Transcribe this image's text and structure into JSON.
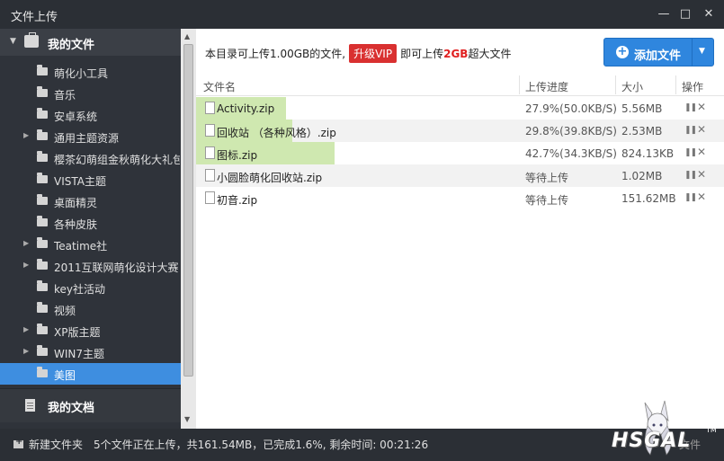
{
  "window": {
    "title": "文件上传",
    "minimize_icon": "—",
    "maximize_icon": "□",
    "close_icon": "✕"
  },
  "sidebar": {
    "header_label": "我的文件",
    "items": [
      {
        "label": "萌化小工具",
        "expandable": false
      },
      {
        "label": "音乐",
        "expandable": false
      },
      {
        "label": "安卓系统",
        "expandable": false
      },
      {
        "label": "通用主题资源",
        "expandable": true
      },
      {
        "label": "樱茶幻萌组金秋萌化大礼包",
        "expandable": false
      },
      {
        "label": "VISTA主题",
        "expandable": false
      },
      {
        "label": "桌面精灵",
        "expandable": false
      },
      {
        "label": "各种皮肤",
        "expandable": false
      },
      {
        "label": "Teatime社",
        "expandable": true
      },
      {
        "label": "2011互联网萌化设计大赛",
        "expandable": true
      },
      {
        "label": "key社活动",
        "expandable": false
      },
      {
        "label": "视频",
        "expandable": false
      },
      {
        "label": "XP版主题",
        "expandable": true
      },
      {
        "label": "WIN7主题",
        "expandable": true
      },
      {
        "label": "美图",
        "expandable": false,
        "selected": true
      }
    ],
    "footer_label": "我的文档"
  },
  "main": {
    "notice": {
      "prefix": "本目录可上传1.00GB的文件,",
      "vip_button": "升级VIP",
      "middle": "即可上传",
      "highlight": "2GB",
      "suffix": "超大文件"
    },
    "add_button_label": "添加文件",
    "columns": {
      "name": "文件名",
      "progress": "上传进度",
      "size": "大小",
      "action": "操作"
    },
    "files": [
      {
        "name": "Activity.zip",
        "progress": "27.9%(50.0KB/S)",
        "size": "5.56MB",
        "progress_fraction": 0.279
      },
      {
        "name": "回收站 （各种风格）.zip",
        "progress": "29.8%(39.8KB/S)",
        "size": "2.53MB",
        "progress_fraction": 0.298
      },
      {
        "name": "图标.zip",
        "progress": "42.7%(34.3KB/S)",
        "size": "824.13KB",
        "progress_fraction": 0.427
      },
      {
        "name": "小圆脸萌化回收站.zip",
        "progress": "等待上传",
        "size": "1.02MB",
        "progress_fraction": 0
      },
      {
        "name": "初音.zip",
        "progress": "等待上传",
        "size": "151.62MB",
        "progress_fraction": 0
      }
    ],
    "pause_icon": "❚❚",
    "delete_icon": "✕"
  },
  "statusbar": {
    "new_folder_label": "新建文件夹",
    "status_text": "5个文件正在上传，共161.54MB，已完成1.6%, 剩余时间: 00:21:26",
    "right_text": "文件"
  },
  "watermark": {
    "brand": "HSGAL",
    "tm": "TM"
  },
  "colors": {
    "accent": "#2f86de",
    "selected": "#3e8ee0",
    "progress": "#cfe8b0",
    "vip": "#d93030"
  }
}
